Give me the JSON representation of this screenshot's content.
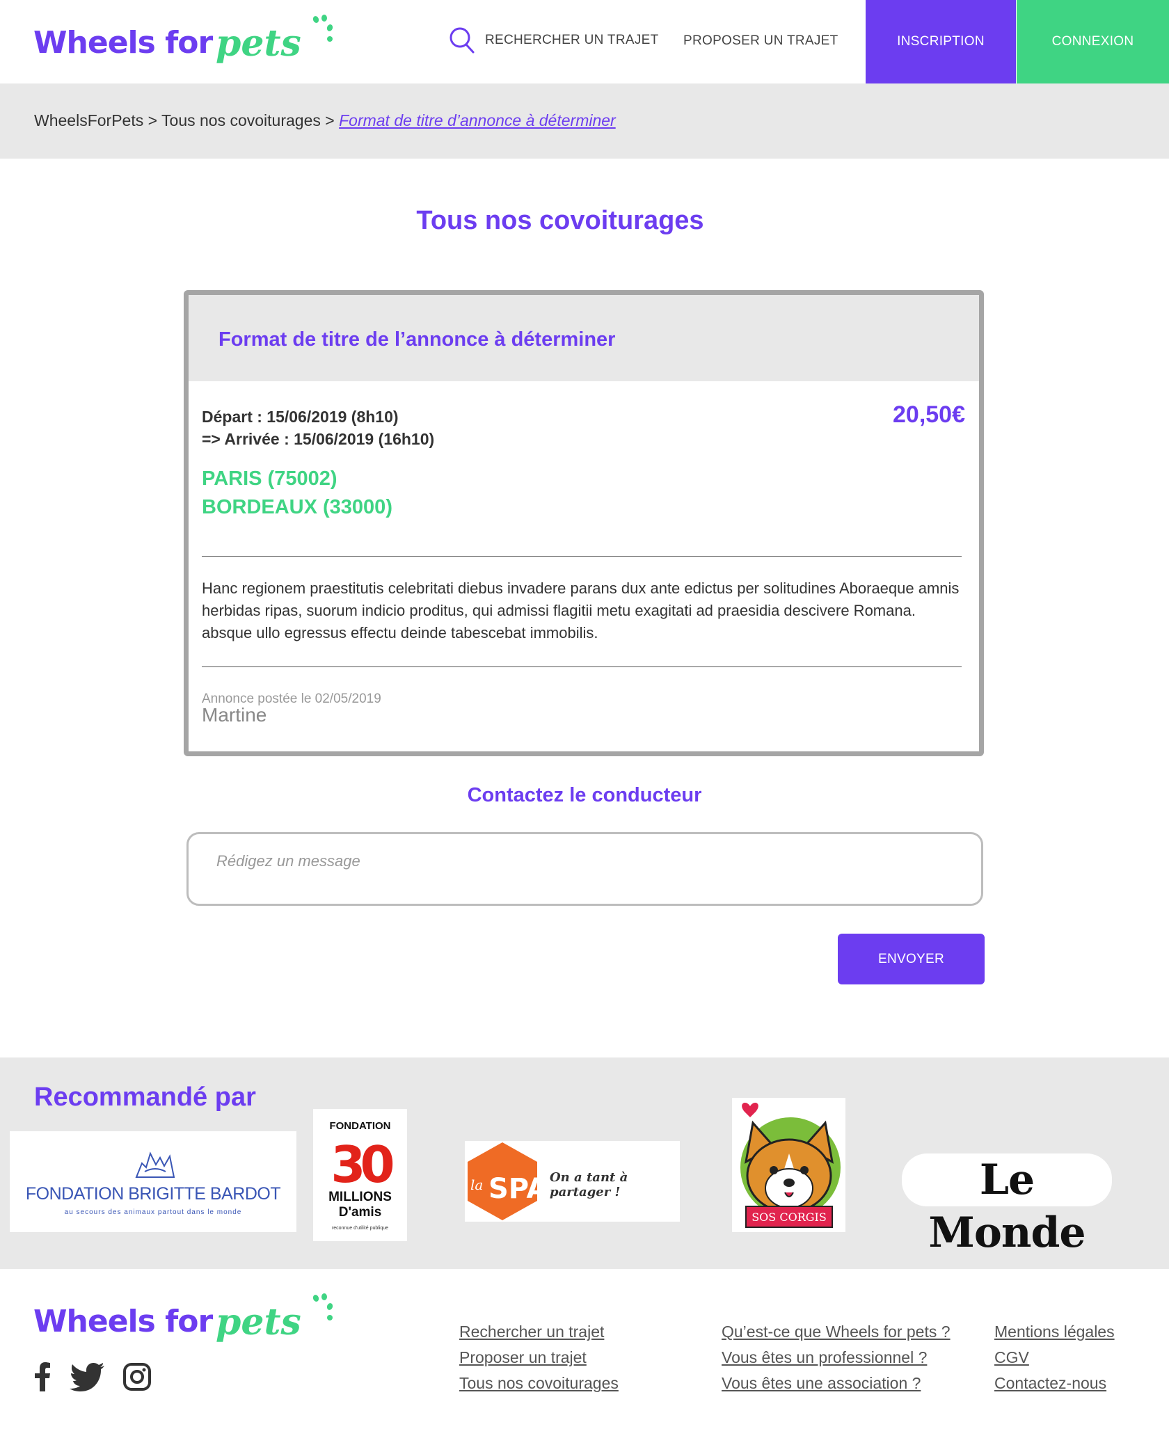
{
  "header": {
    "logo_text": "Wheels for",
    "logo_accent": "pets",
    "nav_search": "RECHERCHER UN TRAJET",
    "nav_propose": "PROPOSER UN TRAJET",
    "btn_inscription": "INSCRIPTION",
    "btn_connexion": "CONNEXION"
  },
  "breadcrumb": {
    "home": "WheelsForPets",
    "sep": ">",
    "section": "Tous nos covoiturages",
    "current": "Format de titre d’annonce à déterminer"
  },
  "page": {
    "title": "Tous nos covoiturages"
  },
  "listing": {
    "title": "Format de titre de l’annonce à déterminer",
    "departure": "Départ : 15/06/2019 (8h10)",
    "arrival": "=> Arrivée : 15/06/2019 (16h10)",
    "price": "20,50€",
    "from_city": "PARIS (75002)",
    "to_city": "BORDEAUX (33000)",
    "description": "Hanc regionem praestitutis celebritati diebus invadere parans dux ante edictus per solitudines Aboraeque amnis herbidas ripas, suorum indicio proditus, qui admissi flagitii metu exagitati ad praesidia descivere Romana. absque ullo egressus effectu deinde tabescebat immobilis.",
    "posted": "Annonce postée le 02/05/2019",
    "author": "Martine"
  },
  "contact": {
    "title": "Contactez le conducteur",
    "placeholder": "Rédigez un message",
    "send_label": "ENVOYER"
  },
  "recommended": {
    "title": "Recommandé par",
    "partners": {
      "fbb_name": "FONDATION BRIGITTE BARDOT",
      "fbb_tagline": "au secours des animaux partout dans le monde",
      "fbb_signature": "Brigitte Bardot",
      "m30_top": "FONDATION",
      "m30_number": "30",
      "m30_line1": "MILLIONS",
      "m30_line2": "D'amis",
      "m30_small": "reconnue d'utilité publique",
      "spa_la": "la",
      "spa_main": "SPA",
      "spa_slogan": "On a tant à partager !",
      "sos_label": "SOS CORGIS",
      "lemonde": "Le Monde"
    }
  },
  "footer": {
    "logo_text": "Wheels for",
    "logo_accent": "pets",
    "col1": [
      "Rechercher un trajet",
      "Proposer un trajet",
      "Tous nos covoiturages"
    ],
    "col2": [
      "Qu’est-ce que Wheels for pets ?",
      "Vous êtes un professionnel ?",
      "Vous êtes une association ?"
    ],
    "col3": [
      "Mentions légales",
      "CGV",
      "Contactez-nous"
    ]
  },
  "colors": {
    "brand_purple": "#6c3df0",
    "brand_green": "#3fd483",
    "gray_band": "#e8e8e8"
  },
  "icons": [
    "search-icon",
    "facebook-icon",
    "twitter-icon",
    "instagram-icon",
    "paw-dots-icon",
    "heart-icon"
  ]
}
